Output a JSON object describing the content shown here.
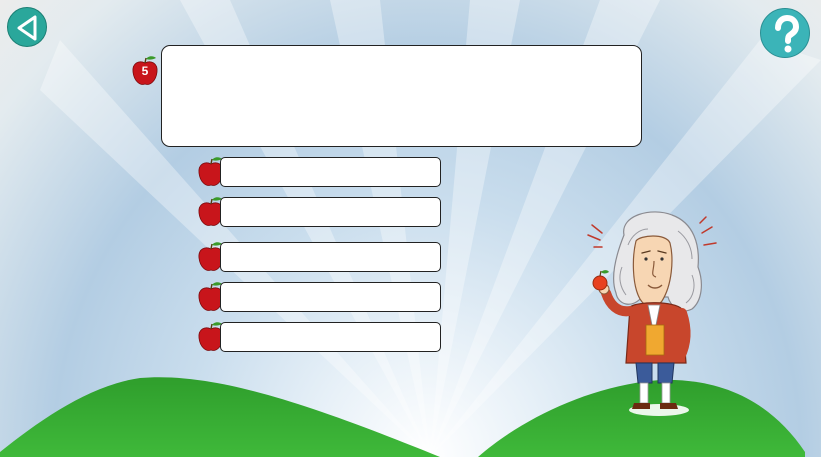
{
  "question": {
    "number": "5",
    "text": ""
  },
  "answers": [
    {
      "label": ""
    },
    {
      "label": ""
    },
    {
      "label": ""
    },
    {
      "label": ""
    },
    {
      "label": ""
    }
  ],
  "colors": {
    "hill_green": "#2c9a2a",
    "button_teal": "#2aa79b",
    "help_teal": "#3bb4b8",
    "apple_red": "#c8151b"
  },
  "icons": {
    "back": "back-arrow-icon",
    "help": "question-mark-icon",
    "apple": "apple-icon"
  }
}
